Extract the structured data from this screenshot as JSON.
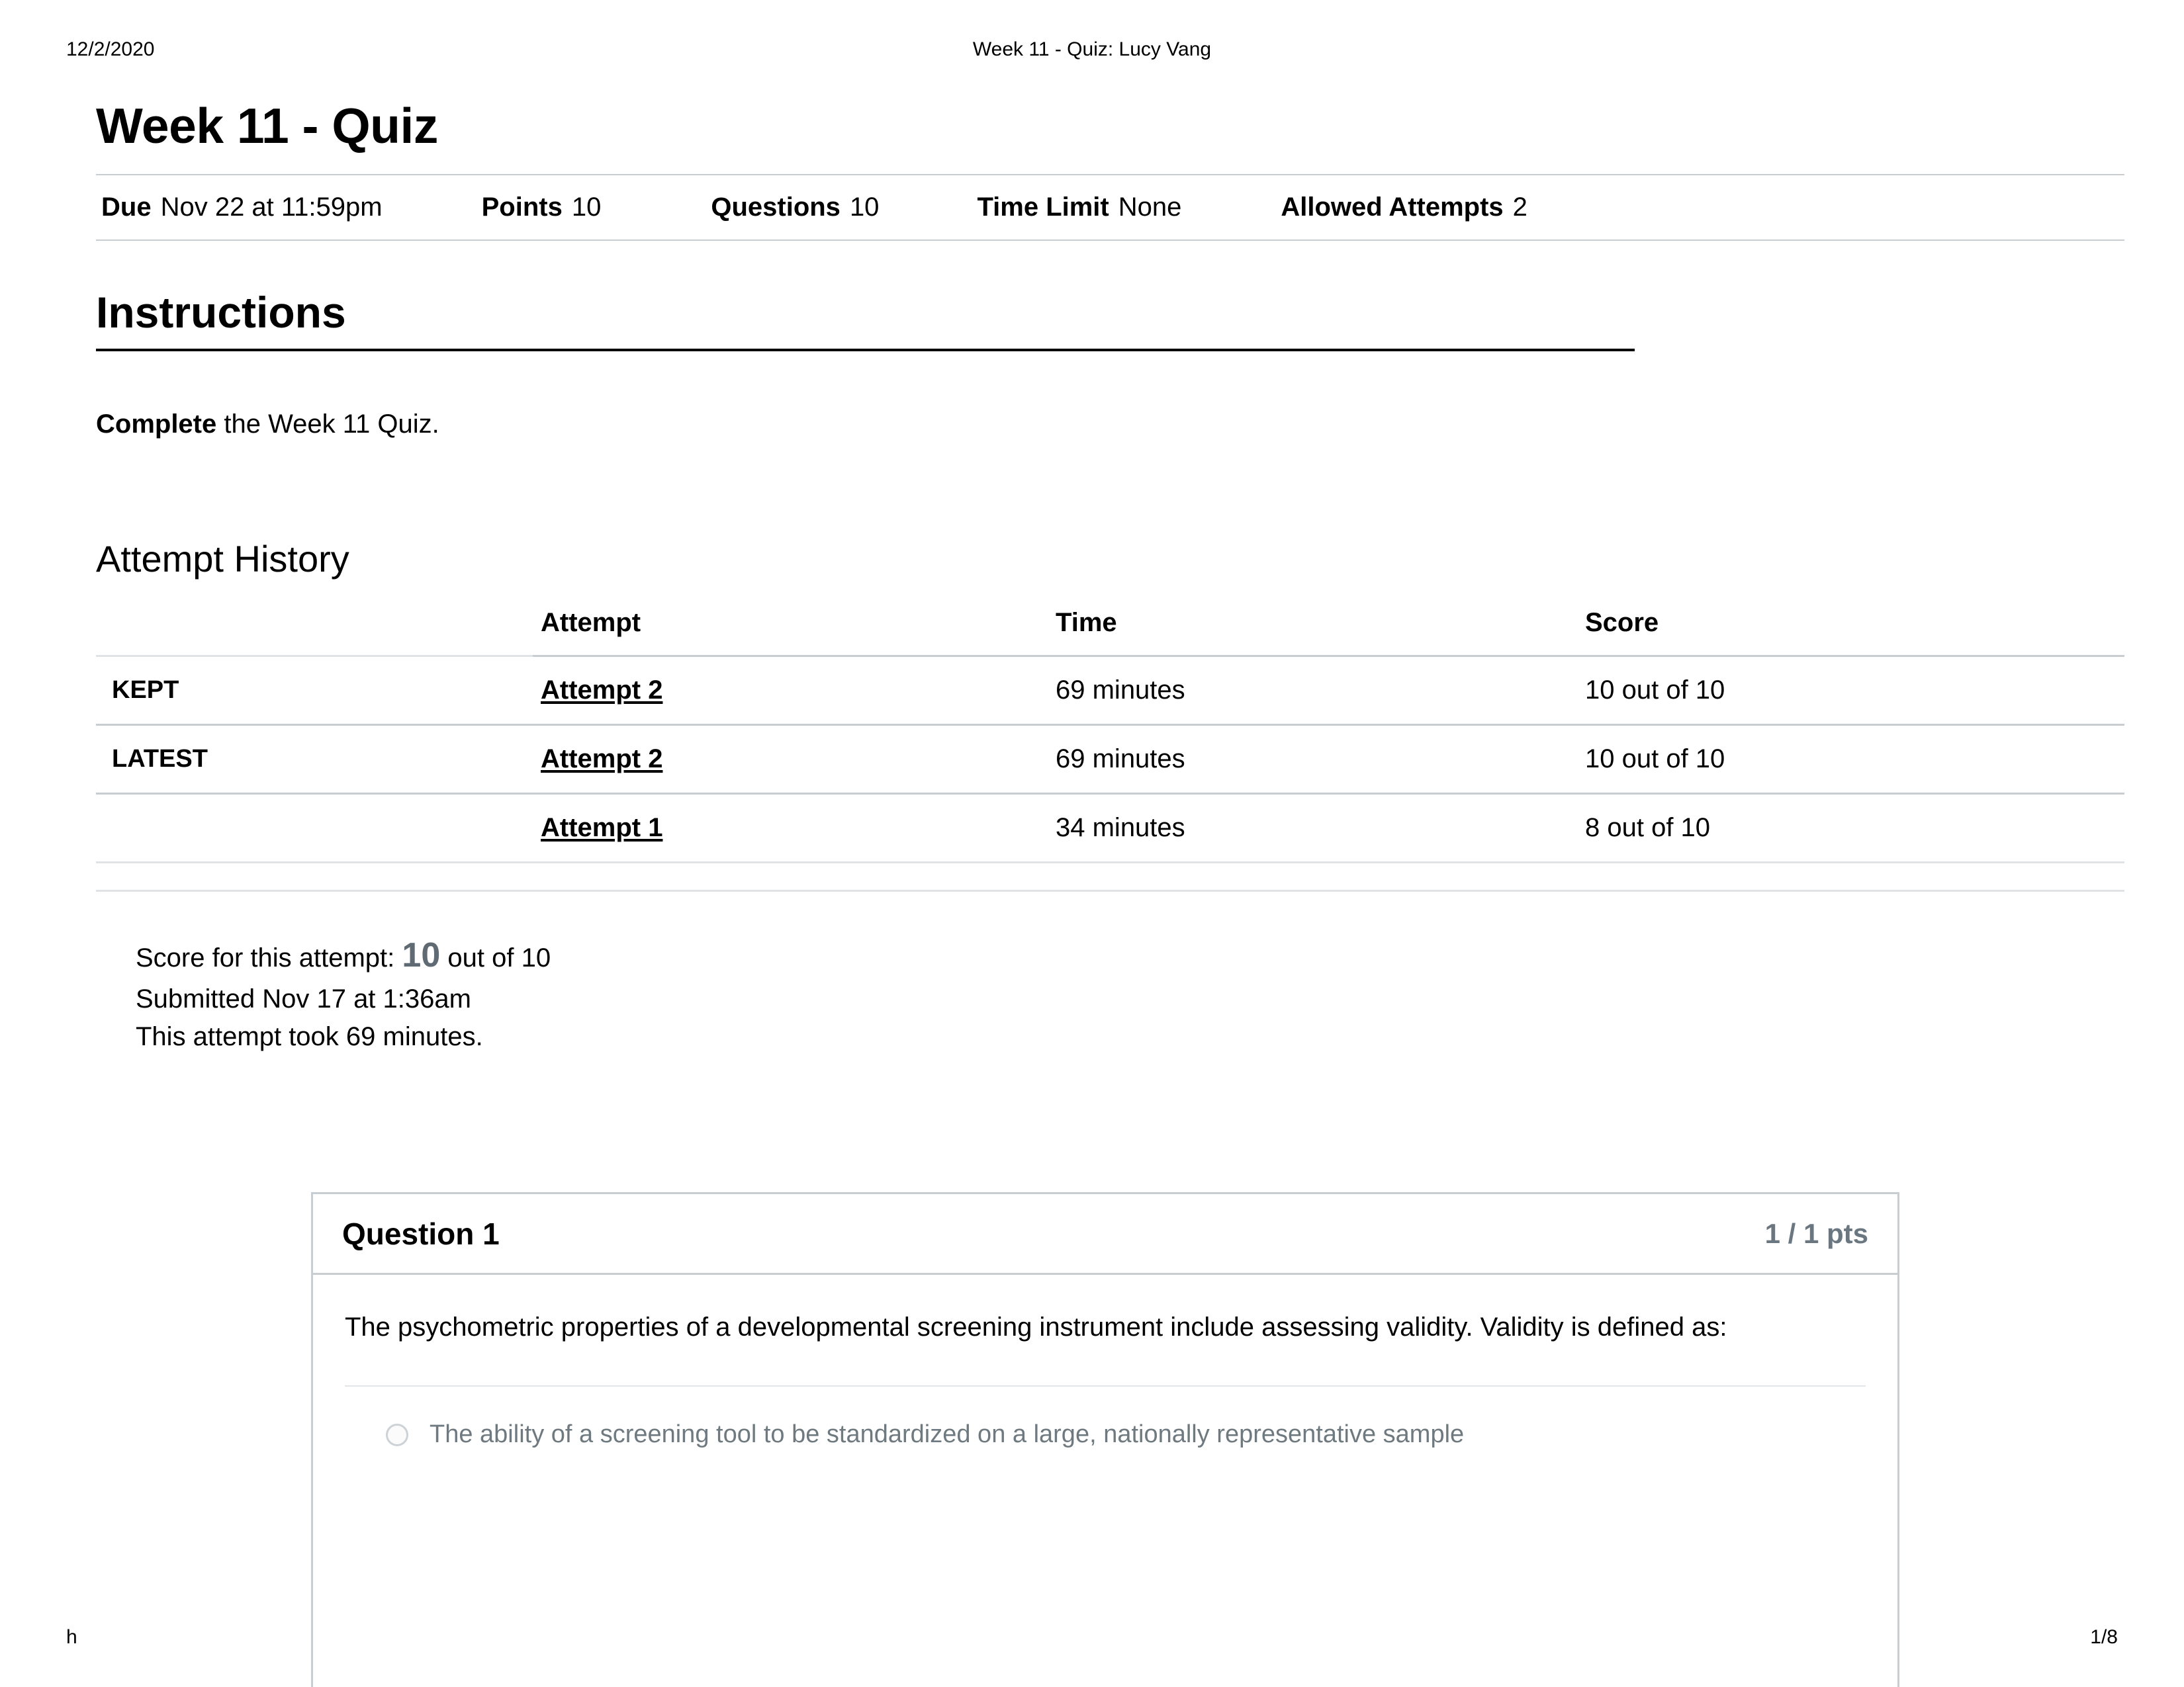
{
  "print": {
    "date": "12/2/2020",
    "doc_title": "Week 11 - Quiz: Lucy Vang",
    "footer_left": "h",
    "footer_page": "1/8"
  },
  "quiz": {
    "title": "Week 11 - Quiz",
    "meta": [
      {
        "label": "Due",
        "value": "Nov 22 at 11:59pm"
      },
      {
        "label": "Points",
        "value": "10"
      },
      {
        "label": "Questions",
        "value": "10"
      },
      {
        "label": "Time Limit",
        "value": "None"
      },
      {
        "label": "Allowed Attempts",
        "value": "2"
      }
    ]
  },
  "instructions": {
    "heading": "Instructions",
    "bold_lead": "Complete",
    "body": " the Week 11 Quiz."
  },
  "attempt_history": {
    "heading": "Attempt History",
    "columns": [
      "",
      "Attempt",
      "Time",
      "Score"
    ],
    "rows": [
      {
        "status": "KEPT",
        "attempt": "Attempt 2",
        "time": "69 minutes",
        "score": "10 out of 10"
      },
      {
        "status": "LATEST",
        "attempt": "Attempt 2",
        "time": "69 minutes",
        "score": "10 out of 10"
      },
      {
        "status": "",
        "attempt": "Attempt 1",
        "time": "34 minutes",
        "score": "8 out of 10"
      }
    ]
  },
  "score_summary": {
    "score_prefix": "Score for this attempt:",
    "score_value": "10",
    "score_suffix": "out of 10",
    "submitted": "Submitted Nov 17 at 1:36am",
    "duration": "This attempt took 69 minutes."
  },
  "question": {
    "title": "Question 1",
    "points": "1 / 1 pts",
    "text": "The psychometric properties of a developmental screening instrument include assessing validity. Validity is defined as:",
    "answers": [
      {
        "text": "The ability of a screening tool to be standardized on a large, nationally representative sample",
        "selected": false
      }
    ]
  },
  "colors": {
    "rule": "#c7cdd1",
    "muted_text": "#6f7a80",
    "score_gray": "#5f6a72"
  }
}
